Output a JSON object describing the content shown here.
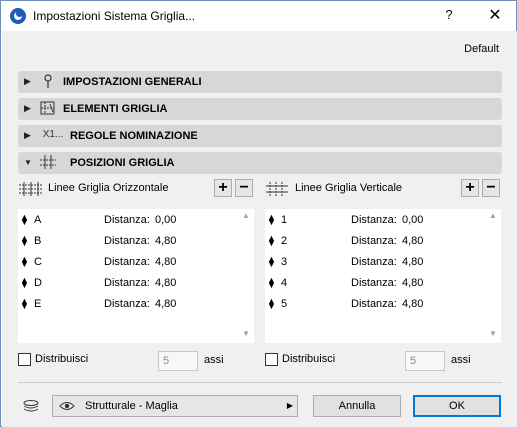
{
  "window": {
    "title": "Impostazioni Sistema Griglia...",
    "help_label": "?",
    "close_label": "✕"
  },
  "preset": {
    "label": "Default"
  },
  "sections": [
    {
      "label": "IMPOSTAZIONI GENERALI",
      "icon": "pin-icon",
      "expanded": false
    },
    {
      "label": "ELEMENTI GRIGLIA",
      "icon": "grid-element-icon",
      "expanded": false
    },
    {
      "label": "REGOLE NOMINAZIONE",
      "icon": "naming-icon",
      "icon_text": "X1...",
      "expanded": false
    },
    {
      "label": "POSIZIONI GRIGLIA",
      "icon": "grid-positions-icon",
      "expanded": true
    }
  ],
  "horizontal": {
    "label": "Linee Griglia Orizzontale",
    "add_label": "+",
    "remove_label": "−",
    "rows": [
      {
        "name": "A",
        "distance_label": "Distanza:",
        "distance": "0,00"
      },
      {
        "name": "B",
        "distance_label": "Distanza:",
        "distance": "4,80"
      },
      {
        "name": "C",
        "distance_label": "Distanza:",
        "distance": "4,80"
      },
      {
        "name": "D",
        "distance_label": "Distanza:",
        "distance": "4,80"
      },
      {
        "name": "E",
        "distance_label": "Distanza:",
        "distance": "4,80"
      }
    ],
    "distribute_label": "Distribuisci",
    "distribute_checked": false,
    "axes_value": "5",
    "axes_label": "assi"
  },
  "vertical": {
    "label": "Linee Griglia Verticale",
    "add_label": "+",
    "remove_label": "−",
    "rows": [
      {
        "name": "1",
        "distance_label": "Distanza:",
        "distance": "0,00"
      },
      {
        "name": "2",
        "distance_label": "Distanza:",
        "distance": "4,80"
      },
      {
        "name": "3",
        "distance_label": "Distanza:",
        "distance": "4,80"
      },
      {
        "name": "4",
        "distance_label": "Distanza:",
        "distance": "4,80"
      },
      {
        "name": "5",
        "distance_label": "Distanza:",
        "distance": "4,80"
      }
    ],
    "distribute_label": "Distribuisci",
    "distribute_checked": false,
    "axes_value": "5",
    "axes_label": "assi"
  },
  "footer": {
    "layer_value": "Strutturale - Maglia",
    "cancel_label": "Annulla",
    "ok_label": "OK"
  },
  "colors": {
    "accent": "#0078d7",
    "section_bg": "#d7d7d7",
    "dialog_bg": "#f0f0f0"
  }
}
